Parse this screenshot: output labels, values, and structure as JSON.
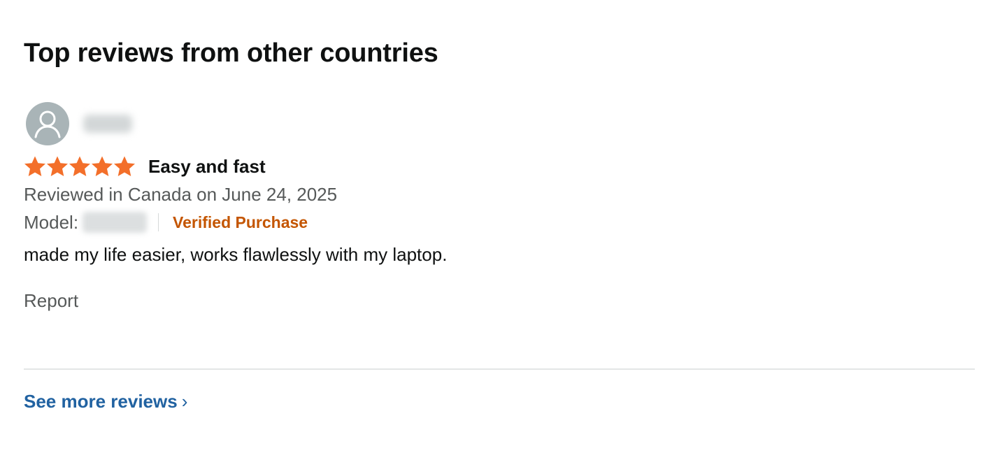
{
  "section": {
    "title": "Top reviews from other countries"
  },
  "review": {
    "profile_name": "",
    "rating": 5,
    "rating_max": 5,
    "star_color": "#f36f2a",
    "title": "Easy and fast",
    "date_line": "Reviewed in Canada on June 24, 2025",
    "model_label": "Model:",
    "model_value": "",
    "verified_label": "Verified Purchase",
    "body": "made my life easier, works flawlessly with my laptop.",
    "report_label": "Report"
  },
  "footer": {
    "see_more_label": "See more reviews",
    "chevron": "›"
  },
  "colors": {
    "link": "#2162a1",
    "verified": "#c45500",
    "secondary_text": "#565959",
    "avatar_bg": "#a9b4b7"
  },
  "icons": {
    "avatar": "user-silhouette-icon",
    "star": "star-icon",
    "chevron": "chevron-right-icon"
  }
}
